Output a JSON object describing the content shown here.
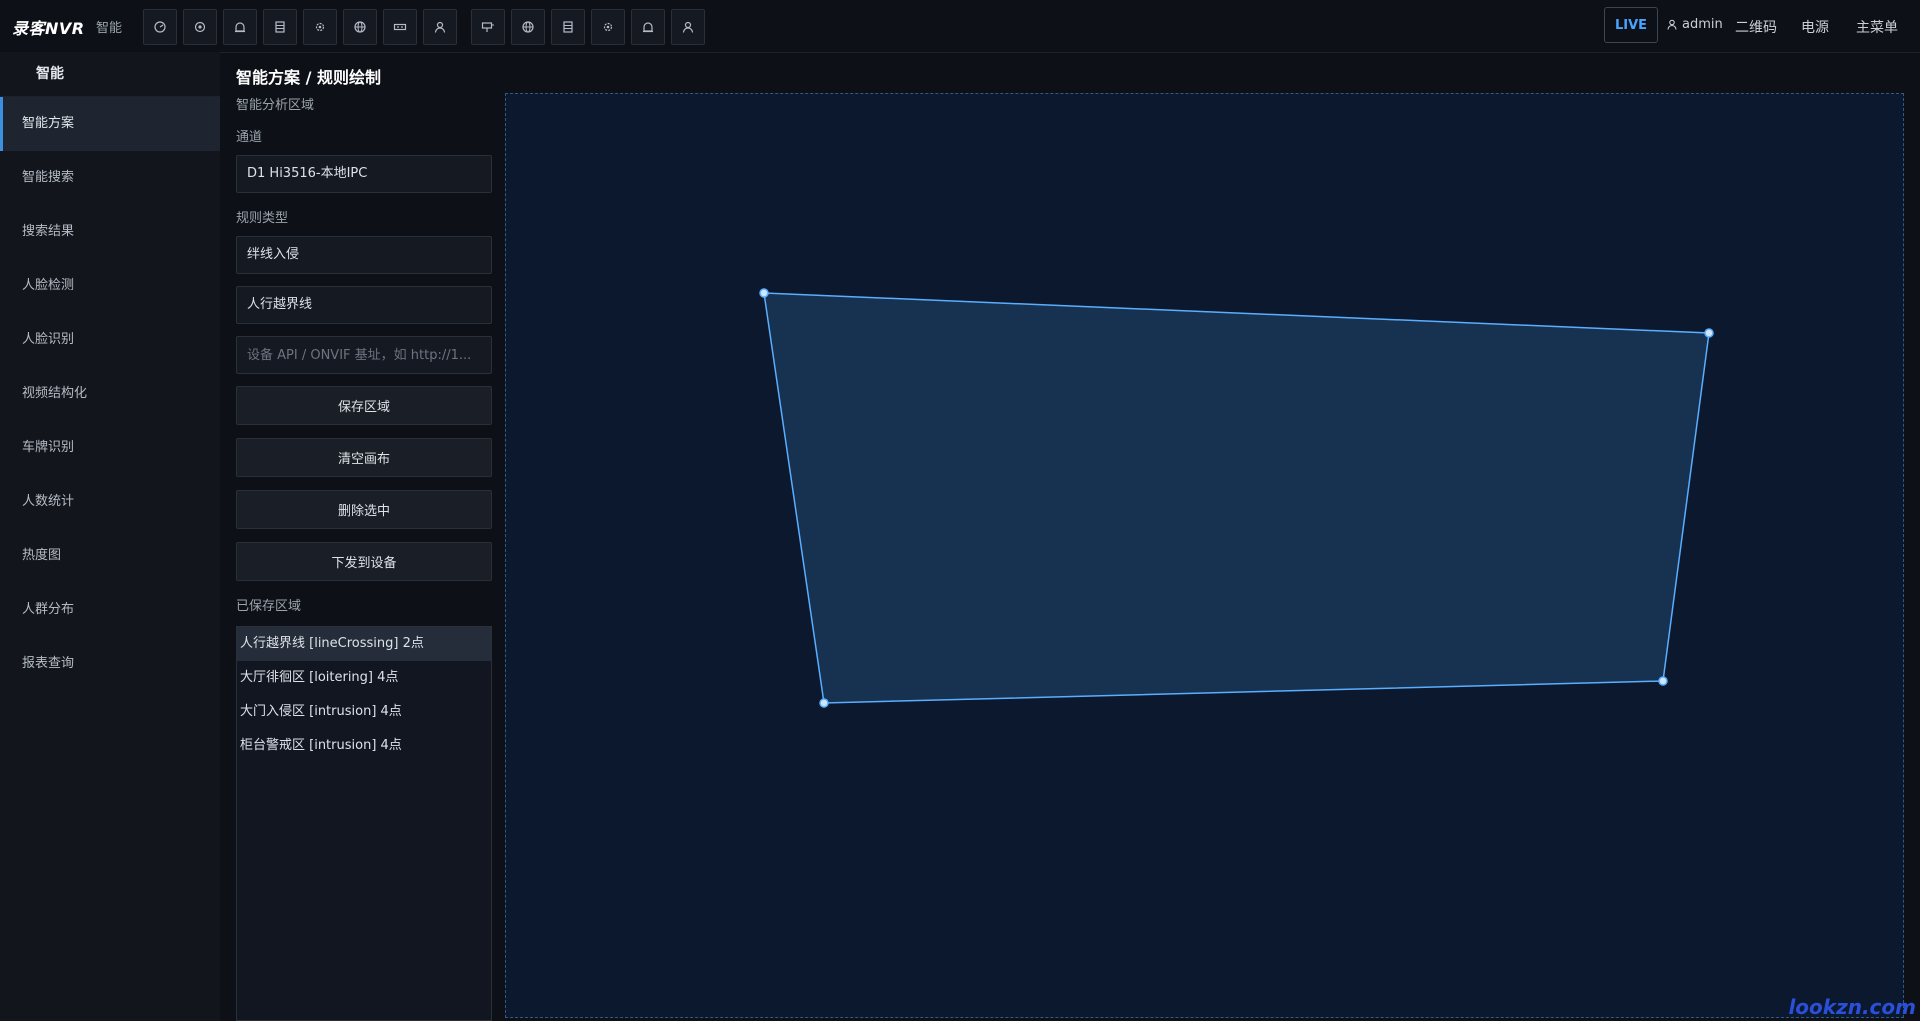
{
  "app": {
    "logo": "录客NVR",
    "section": "智能"
  },
  "toolbar": {
    "icons": [
      "dashboard-icon",
      "target-icon",
      "alarm-icon",
      "storage-icon",
      "settings-icon",
      "network-icon",
      "device-icon",
      "user-icon",
      "monitor-icon",
      "globe-icon",
      "disk-icon",
      "gear-icon",
      "bell-icon",
      "person-icon"
    ]
  },
  "header_right": {
    "live": "LIVE",
    "user": "admin",
    "qrcode": "二维码",
    "power": "电源",
    "main_menu": "主菜单"
  },
  "sidebar": {
    "title": "智能",
    "items": [
      "智能方案",
      "智能搜索",
      "搜索结果",
      "人脸检测",
      "人脸识别",
      "视频结构化",
      "车牌识别",
      "人数统计",
      "热度图",
      "人群分布",
      "报表查询"
    ],
    "active": "智能方案"
  },
  "page": {
    "title": "智能方案 / 规则绘制",
    "subtitle": "智能分析区域"
  },
  "form": {
    "channel_label": "通道",
    "channel_value": "D1 Hi3516-本地IPC",
    "rule_type_label": "规则类型",
    "rule_type_value": "绊线入侵",
    "rule_name_value": "人行越界线",
    "api_placeholder": "设备 API / ONVIF 基址，如 http://1..."
  },
  "buttons": {
    "save": "保存区域",
    "clear": "清空画布",
    "delete": "删除选中",
    "push": "下发到设备"
  },
  "saved": {
    "label": "已保存区域",
    "items": [
      "人行越界线 [lineCrossing] 2点",
      "大厅徘徊区 [loitering] 4点",
      "大门入侵区 [intrusion] 4点",
      "柜台警戒区 [intrusion] 4点"
    ]
  },
  "colors": {
    "accent": "#4aa3ff",
    "region_stroke": "#5aaeff",
    "region_fill": "#1a3658",
    "canvas_bg": "#0c182d"
  },
  "watermark": "lookzn.com"
}
